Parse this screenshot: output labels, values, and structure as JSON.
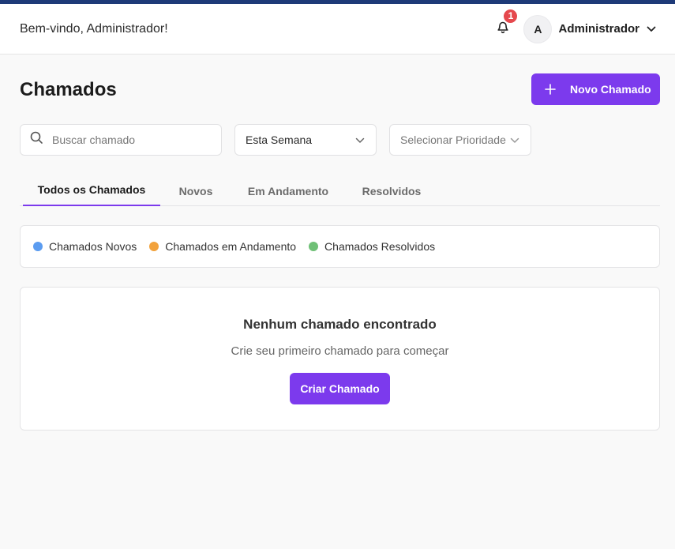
{
  "header": {
    "welcome": "Bem-vindo, Administrador!",
    "notification_count": "1",
    "avatar_initial": "A",
    "user_name": "Administrador"
  },
  "page": {
    "title": "Chamados",
    "new_button_label": "Novo Chamado"
  },
  "filters": {
    "search_placeholder": "Buscar chamado",
    "period_selected": "Esta Semana",
    "priority_placeholder": "Selecionar Prioridade"
  },
  "tabs": [
    {
      "label": "Todos os Chamados",
      "active": true
    },
    {
      "label": "Novos",
      "active": false
    },
    {
      "label": "Em Andamento",
      "active": false
    },
    {
      "label": "Resolvidos",
      "active": false
    }
  ],
  "legend": [
    {
      "label": "Chamados Novos",
      "color": "#5b9cf0"
    },
    {
      "label": "Chamados em Andamento",
      "color": "#f2a23c"
    },
    {
      "label": "Chamados Resolvidos",
      "color": "#6fc076"
    }
  ],
  "empty_state": {
    "title": "Nenhum chamado encontrado",
    "subtitle": "Crie seu primeiro chamado para começar",
    "button_label": "Criar Chamado"
  },
  "theme": {
    "accent": "#7c3aed",
    "top_strip": "#1e3a78",
    "badge": "#e5484d"
  },
  "icons": {
    "notification": "bell-icon",
    "user_menu": "chevron-down-icon",
    "new_ticket": "plus-icon",
    "search": "search-icon",
    "select": "chevron-down-icon"
  }
}
